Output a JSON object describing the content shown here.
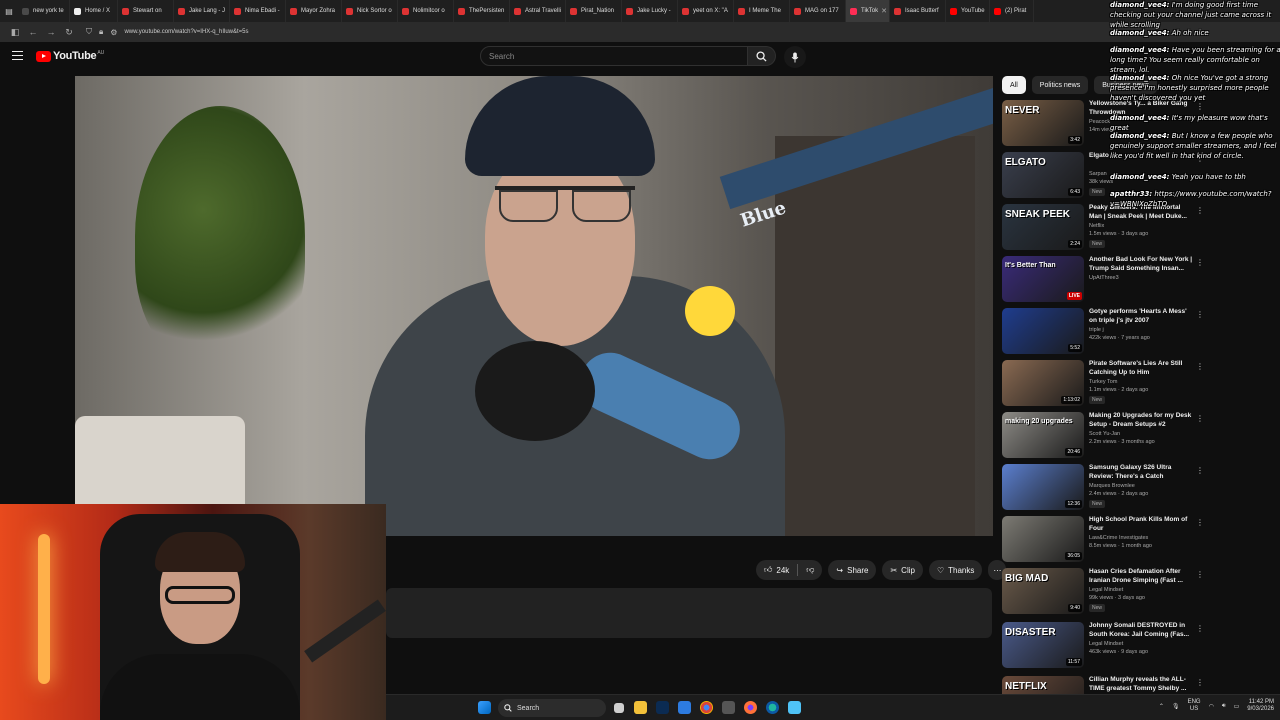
{
  "browser": {
    "tabs": [
      {
        "label": "new york te"
      },
      {
        "label": "Home / X"
      },
      {
        "label": "Stewart on"
      },
      {
        "label": "Jake Lang - J"
      },
      {
        "label": "Nima Ebadi -"
      },
      {
        "label": "Mayor Zohra"
      },
      {
        "label": "Nick Sortor o"
      },
      {
        "label": "Nolimitcor o"
      },
      {
        "label": "ThePersisten"
      },
      {
        "label": "Astral Travelli"
      },
      {
        "label": "Pirat_Nation"
      },
      {
        "label": "Jake Lucky -"
      },
      {
        "label": "yeet on X: \"A"
      },
      {
        "label": "I Meme The"
      },
      {
        "label": "MAG on 177"
      },
      {
        "label": "TikTok"
      },
      {
        "label": "Isaac Butterf"
      },
      {
        "label": "YouTube"
      },
      {
        "label": "(2) Pirat"
      }
    ],
    "active_tab_index": 15,
    "url": "www.youtube.com/watch?v=IHX-q_hIluw&t=5s"
  },
  "youtube": {
    "logo_text": "YouTube",
    "country_code": "AU",
    "search_placeholder": "Search",
    "video": {
      "mic_brand": "Blue"
    },
    "actions": {
      "likes": "24k",
      "share": "Share",
      "clip": "Clip",
      "thanks": "Thanks"
    },
    "chips": [
      "All",
      "Politics news",
      "Business news"
    ],
    "recommendations": [
      {
        "title": "Yellowstone's Ty... a Biker Gang Throwdown",
        "channel": "Peacock",
        "meta": "14m views",
        "duration": "3:42",
        "thumb_text": "NEVER",
        "thumb_bg": "#7a5f46"
      },
      {
        "title": "Elgato ...",
        "channel": "Sarpan",
        "meta": "38k views",
        "duration": "6:43",
        "thumb_text": "ELGATO",
        "thumb_bg": "#3a3f4d",
        "badge": "New"
      },
      {
        "title": "Peaky Blinders: The Immortal Man | Sneak Peek | Meet Duke...",
        "channel": "Netflix",
        "meta": "1.5m views · 3 days ago",
        "duration": "2:24",
        "thumb_text": "SNEAK PEEK",
        "thumb_bg": "#2a3440",
        "badge": "New"
      },
      {
        "title": "Another Bad Look For New York | Trump Said Something Insan...",
        "channel": "UpAtThree3",
        "meta": "",
        "live": "LIVE",
        "thumb_text": "It's Better Than",
        "thumb_bg": "#3a2b7a"
      },
      {
        "title": "Gotye performs 'Hearts A Mess' on triple j's jtv 2007",
        "channel": "triple j",
        "meta": "422k views · 7 years ago",
        "duration": "5:52",
        "thumb_text": "",
        "thumb_bg": "#1f3d8f"
      },
      {
        "title": "Pirate Software's Lies Are Still Catching Up to Him",
        "channel": "Turkey Tom",
        "meta": "1.1m views · 2 days ago",
        "duration": "1:13:02",
        "thumb_text": "",
        "thumb_bg": "#8a6a52",
        "badge": "New"
      },
      {
        "title": "Making 20 Upgrades for my Desk Setup - Dream Setups #2",
        "channel": "Scott Yu-Jan",
        "meta": "2.2m views · 3 months ago",
        "duration": "20:46",
        "thumb_text": "making 20 upgrades",
        "thumb_bg": "#8d8b86"
      },
      {
        "title": "Samsung Galaxy S26 Ultra Review: There's a Catch",
        "channel": "Marques Brownlee",
        "meta": "2.4m views · 2 days ago",
        "duration": "12:36",
        "thumb_text": "",
        "thumb_bg": "#5b7fcf",
        "badge": "New"
      },
      {
        "title": "High School Prank Kills Mom of Four",
        "channel": "Law&Crime Investigates",
        "meta": "8.5m views · 1 month ago",
        "duration": "36:05",
        "thumb_text": "",
        "thumb_bg": "#7d7b74"
      },
      {
        "title": "Hasan Cries Defamation After Iranian Drone Simping (Fast ...",
        "channel": "Legal Mindset",
        "meta": "99k views · 3 days ago",
        "duration": "9:40",
        "thumb_text": "BIG MAD",
        "thumb_bg": "#6a5a4a",
        "badge": "New"
      },
      {
        "title": "Johnny Somali DESTROYED in South Korea: Jail Coming (Fas...",
        "channel": "Legal Mindset",
        "meta": "463k views · 9 days ago",
        "duration": "11:57",
        "thumb_text": "DISASTER",
        "thumb_bg": "#4a5a8a"
      },
      {
        "title": "Cillian Murphy reveals the ALL-TIME greatest Tommy Shelby ...",
        "channel": "",
        "meta": "",
        "thumb_text": "NETFLIX",
        "thumb_bg": "#6a4a3a"
      }
    ]
  },
  "chat": [
    {
      "user": "diamond_vee4:",
      "text": "I'm doing good first time checking out your channel just came across it while scrolling"
    },
    {
      "user": "diamond_vee4:",
      "text": "Ah oh nice"
    },
    {
      "user": "diamond_vee4:",
      "text": "Have you been streaming for a long time? You seem really comfortable on stream, lol."
    },
    {
      "user": "diamond_vee4:",
      "text": "Oh nice You've got a strong presence I'm honestly surprised more people haven't discovered you yet"
    },
    {
      "user": "diamond_vee4:",
      "text": "It's my pleasure wow that's great"
    },
    {
      "user": "diamond_vee4:",
      "text": "But I know a few people who genuinely support smaller streamers, and I feel like you'd fit well in that kind of circle."
    },
    {
      "user": "diamond_vee4:",
      "text": "Yeah you have to tbh"
    },
    {
      "user": "apatthr33:",
      "text": "https://www.youtube.com/watch?v=WBNIXoZbTQ"
    }
  ],
  "taskbar": {
    "search_label": "Search",
    "lang_top": "ENG",
    "lang_bottom": "US",
    "time": "11:42 PM",
    "date": "9/03/2026"
  },
  "colors": {
    "youtube_red": "#ff0000",
    "bg": "#0f0f0f",
    "pill": "#272727"
  }
}
